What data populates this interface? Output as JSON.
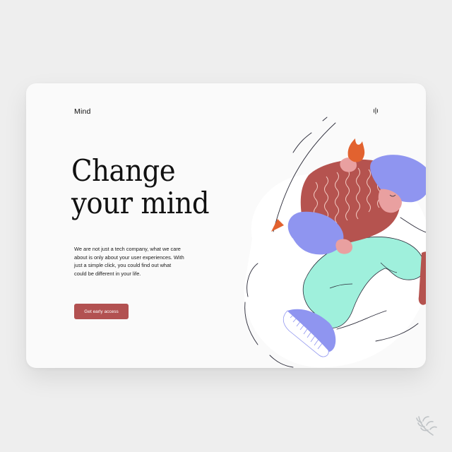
{
  "header": {
    "logo": "Mind",
    "menu_icon": "menu-bars-icon"
  },
  "hero": {
    "title": "Change\nyour mind",
    "description": "We are not just a tech company, what we care about is only about your user experiences. With just a simple click, you could find out what could be different in your life.",
    "cta_label": "Get early access"
  },
  "illustration": {
    "subject": "person-falling-illustration"
  },
  "colors": {
    "background": "#eeeeee",
    "card": "#fafafa",
    "accent": "#b25151",
    "sweater": "#b5534f",
    "sleeve_purple": "#8f95f0",
    "pants_mint": "#9ff0dc",
    "arrow_orange": "#e2622f",
    "skin": "#e9a0a0"
  },
  "corner_badge": "laurel-icon"
}
